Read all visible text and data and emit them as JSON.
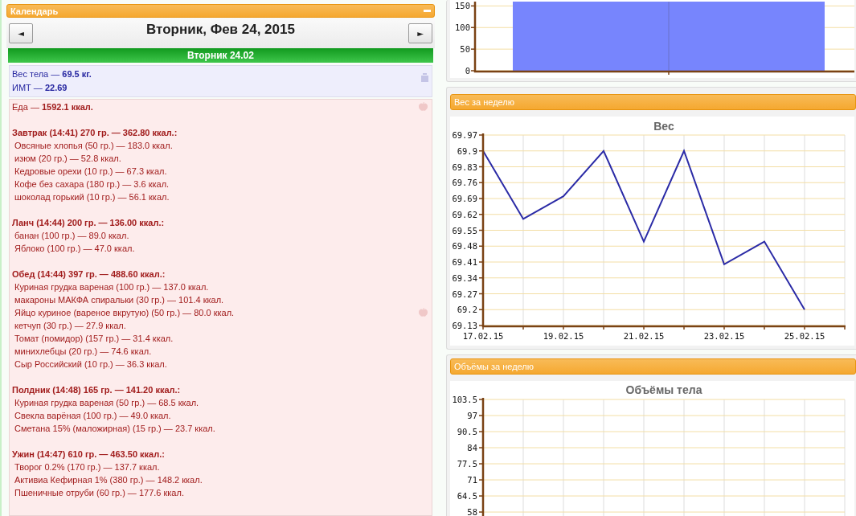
{
  "calendar": {
    "title": "Календарь",
    "prev_button": "◄",
    "next_button": "►",
    "date": "Вторник, Фев 24, 2015",
    "day_header": "Вторник 24.02",
    "body_stats": [
      "Вес тела — **69.5 кг.**",
      "ИМТ — **22.69**"
    ],
    "food_total": "Еда — **1592.1 ккал.**",
    "meals": [
      {
        "title": "Завтрак (14:41) 270 гр. — 362.80 ккал.:",
        "items": [
          "Овсяные хлопья (50 гр.) — 183.0 ккал.",
          "изюм (20 гр.) — 52.8 ккал.",
          "Кедровые орехи (10 гр.) — 67.3 ккал.",
          "Кофе без сахара (180 гр.) — 3.6 ккал.",
          "шоколад горький (10 гр.) — 56.1 ккал."
        ]
      },
      {
        "title": "Ланч (14:44) 200 гр. — 136.00 ккал.:",
        "items": [
          "банан (100 гр.) — 89.0 ккал.",
          "Яблоко (100 гр.) — 47.0 ккал."
        ]
      },
      {
        "title": "Обед (14:44) 397 гр. — 488.60 ккал.:",
        "items": [
          "Куриная грудка вареная (100 гр.) — 137.0 ккал.",
          "макароны МАКФА спиральки (30 гр.) — 101.4 ккал.",
          "Яйцо куриное (вареное вкрутую) (50 гр.) — 80.0 ккал.",
          "кетчуп (30 гр.) — 27.9 ккал.",
          "Томат (помидор) (157 гр.) — 31.4 ккал.",
          "минихлебцы (20 гр.) — 74.6 ккал.",
          "Сыр Российский (10 гр.) — 36.3 ккал."
        ]
      },
      {
        "title": "Полдник (14:48) 165 гр. — 141.20 ккал.:",
        "items": [
          "Куриная грудка вареная (50 гр.) — 68.5 ккал.",
          "Свекла варёная (100 гр.) — 49.0 ккал.",
          "Сметана 15% (маложирная) (15 гр.) — 23.7 ккал."
        ]
      },
      {
        "title": "Ужин (14:47) 610 гр. — 463.50 ккал.:",
        "items": [
          "Творог 0.2% (170 гр.) — 137.7 ккал.",
          "Активиа Кефирная 1% (380 гр.) — 148.2 ккал.",
          "Пшеничные отруби (60 гр.) — 177.6 ккал."
        ]
      }
    ]
  },
  "top_chart": {
    "chart_data": {
      "type": "bar",
      "categories": [
        null
      ],
      "grid": true,
      "ylim": [
        0,
        160
      ],
      "yticks": [
        0,
        50,
        100,
        150
      ]
    }
  },
  "weight_panel": {
    "title": "Вес за неделю",
    "chart_data": {
      "type": "line",
      "title": "Вес",
      "grid": true,
      "categories": [
        "17.02.15",
        null,
        "19.02.15",
        null,
        "21.02.15",
        null,
        "23.02.15",
        null,
        "25.02.15"
      ],
      "ylim": [
        69.13,
        69.97
      ],
      "yticks": [
        69.13,
        69.2,
        69.27,
        69.34,
        69.41,
        69.48,
        69.55,
        69.62,
        69.69,
        69.76,
        69.83,
        69.9,
        69.97
      ],
      "series": [
        {
          "color": "#2b2ba6",
          "values": [
            69.9,
            69.6,
            69.7,
            69.9,
            69.5,
            69.9,
            69.4,
            69.5,
            69.2
          ]
        }
      ]
    }
  },
  "volumes_panel": {
    "title": "Объёмы за неделю",
    "chart_data": {
      "type": "line",
      "title": "Объёмы тела",
      "grid": true,
      "categories": [
        null,
        null,
        null,
        null,
        null,
        null,
        null,
        null,
        null
      ],
      "ylim": [
        52.5,
        103.5
      ],
      "yticks": [
        58,
        64.5,
        71,
        77.5,
        84,
        90.5,
        97,
        103.5
      ]
    }
  }
}
